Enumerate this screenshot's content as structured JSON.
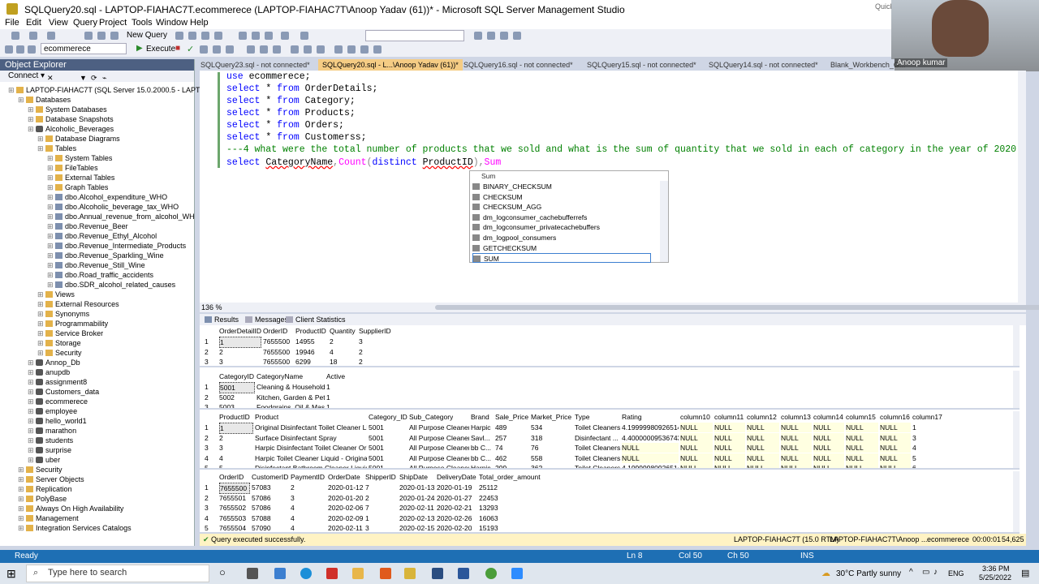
{
  "window": {
    "title": "SQLQuery20.sql - LAPTOP-FIAHAC7T.ecommerece (LAPTOP-FIAHAC7T\\Anoop Yadav (61))* - Microsoft SQL Server Management Studio",
    "quick_launch": "Quick"
  },
  "menu": [
    "File",
    "Edit",
    "View",
    "Query",
    "Project",
    "Tools",
    "Window",
    "Help"
  ],
  "toolbar": {
    "new_query": "New Query",
    "db_selector": "ecommerece",
    "execute": "Execute"
  },
  "webcam": {
    "name": "Anoop kumar"
  },
  "object_explorer": {
    "title": "Object Explorer",
    "connect": "Connect ▾",
    "nodes": [
      {
        "label": "LAPTOP-FIAHAC7T (SQL Server 15.0.2000.5 - LAPTOP-F",
        "level": 0,
        "icon": "server"
      },
      {
        "label": "Databases",
        "level": 1,
        "icon": "folder"
      },
      {
        "label": "System Databases",
        "level": 2,
        "icon": "folder"
      },
      {
        "label": "Database Snapshots",
        "level": 2,
        "icon": "folder"
      },
      {
        "label": "Alcoholic_Beverages",
        "level": 2,
        "icon": "db"
      },
      {
        "label": "Database Diagrams",
        "level": 3,
        "icon": "folder"
      },
      {
        "label": "Tables",
        "level": 3,
        "icon": "folder"
      },
      {
        "label": "System Tables",
        "level": 4,
        "icon": "folder"
      },
      {
        "label": "FileTables",
        "level": 4,
        "icon": "folder"
      },
      {
        "label": "External Tables",
        "level": 4,
        "icon": "folder"
      },
      {
        "label": "Graph Tables",
        "level": 4,
        "icon": "folder"
      },
      {
        "label": "dbo.Alcohol_expenditure_WHO",
        "level": 4,
        "icon": "table"
      },
      {
        "label": "dbo.Alcoholic_beverage_tax_WHO",
        "level": 4,
        "icon": "table"
      },
      {
        "label": "dbo.Annual_revenue_from_alcohol_WH",
        "level": 4,
        "icon": "table"
      },
      {
        "label": "dbo.Revenue_Beer",
        "level": 4,
        "icon": "table"
      },
      {
        "label": "dbo.Revenue_Ethyl_Alcohol",
        "level": 4,
        "icon": "table"
      },
      {
        "label": "dbo.Revenue_Intermediate_Products",
        "level": 4,
        "icon": "table"
      },
      {
        "label": "dbo.Revenue_Sparkling_Wine",
        "level": 4,
        "icon": "table"
      },
      {
        "label": "dbo.Revenue_Still_Wine",
        "level": 4,
        "icon": "table"
      },
      {
        "label": "dbo.Road_traffic_accidents",
        "level": 4,
        "icon": "table"
      },
      {
        "label": "dbo.SDR_alcohol_related_causes",
        "level": 4,
        "icon": "table"
      },
      {
        "label": "Views",
        "level": 3,
        "icon": "folder"
      },
      {
        "label": "External Resources",
        "level": 3,
        "icon": "folder"
      },
      {
        "label": "Synonyms",
        "level": 3,
        "icon": "folder"
      },
      {
        "label": "Programmability",
        "level": 3,
        "icon": "folder"
      },
      {
        "label": "Service Broker",
        "level": 3,
        "icon": "folder"
      },
      {
        "label": "Storage",
        "level": 3,
        "icon": "folder"
      },
      {
        "label": "Security",
        "level": 3,
        "icon": "folder"
      },
      {
        "label": "Annop_Db",
        "level": 2,
        "icon": "db"
      },
      {
        "label": "anupdb",
        "level": 2,
        "icon": "db"
      },
      {
        "label": "assignment8",
        "level": 2,
        "icon": "db"
      },
      {
        "label": "Customers_data",
        "level": 2,
        "icon": "db"
      },
      {
        "label": "ecommerece",
        "level": 2,
        "icon": "db"
      },
      {
        "label": "employee",
        "level": 2,
        "icon": "db"
      },
      {
        "label": "hello_world1",
        "level": 2,
        "icon": "db"
      },
      {
        "label": "marathon",
        "level": 2,
        "icon": "db"
      },
      {
        "label": "students",
        "level": 2,
        "icon": "db"
      },
      {
        "label": "surprise",
        "level": 2,
        "icon": "db"
      },
      {
        "label": "uber",
        "level": 2,
        "icon": "db"
      },
      {
        "label": "Security",
        "level": 1,
        "icon": "folder"
      },
      {
        "label": "Server Objects",
        "level": 1,
        "icon": "folder"
      },
      {
        "label": "Replication",
        "level": 1,
        "icon": "folder"
      },
      {
        "label": "PolyBase",
        "level": 1,
        "icon": "folder"
      },
      {
        "label": "Always On High Availability",
        "level": 1,
        "icon": "folder"
      },
      {
        "label": "Management",
        "level": 1,
        "icon": "folder"
      },
      {
        "label": "Integration Services Catalogs",
        "level": 1,
        "icon": "folder"
      }
    ]
  },
  "tabs": [
    {
      "label": "SQLQuery23.sql - not connected*",
      "active": false
    },
    {
      "label": "SQLQuery20.sql - L...\\Anoop Yadav (61))*",
      "active": true
    },
    {
      "label": "SQLQuery16.sql - not connected*",
      "active": false
    },
    {
      "label": "SQLQuery15.sql - not connected*",
      "active": false
    },
    {
      "label": "SQLQuery14.sql - not connected*",
      "active": false
    },
    {
      "label": "Blank_Workbench_G...",
      "active": false
    }
  ],
  "editor": {
    "lines": [
      "use ecommerece;",
      "select * from OrderDetails;",
      "select * from Category;",
      "select * from Products;",
      "select * from Orders;",
      "select * from Customerss;",
      "---4 what were the total number of products that we sold and what is the sum of quantity that we sold in each of category in the year of 2020",
      "select CategoryName,Count(distinct ProductID),Sum"
    ],
    "zoom": "136 %"
  },
  "autocomplete": {
    "header": "Sum",
    "items": [
      "BINARY_CHECKSUM",
      "CHECKSUM",
      "CHECKSUM_AGG",
      "dm_logconsumer_cachebufferrefs",
      "dm_logconsumer_privatecachebuffers",
      "dm_logpool_consumers",
      "GETCHECKSUM",
      "SUM"
    ]
  },
  "result_tabs": [
    "Results",
    "Messages",
    "Client Statistics"
  ],
  "grid1": {
    "columns": [
      "OrderDetailID",
      "OrderID",
      "ProductID",
      "Quantity",
      "SupplierID"
    ],
    "rows": [
      [
        "1",
        "7655500",
        "14955",
        "2",
        "3"
      ],
      [
        "2",
        "7655500",
        "19946",
        "4",
        "2"
      ],
      [
        "3",
        "7655500",
        "6299",
        "18",
        "2"
      ]
    ]
  },
  "grid2": {
    "columns": [
      "CategoryID",
      "CategoryName",
      "Active"
    ],
    "rows": [
      [
        "5001",
        "Cleaning & Household",
        "1"
      ],
      [
        "5002",
        "Kitchen, Garden & Pets",
        "1"
      ],
      [
        "5003",
        "Foodgrains, Oil & Mas...",
        "1"
      ]
    ]
  },
  "grid3": {
    "columns": [
      "ProductID",
      "Product",
      "Category_ID",
      "Sub_Category",
      "Brand",
      "Sale_Price",
      "Market_Price",
      "Type",
      "Rating",
      "column10",
      "column11",
      "column12",
      "column13",
      "column14",
      "column15",
      "column16",
      "column17"
    ],
    "rows": [
      [
        "1",
        "Original Disinfectant Toilet Cleaner Liquid",
        "5001",
        "All Purpose Cleaners",
        "Harpic",
        "489",
        "534",
        "Toilet Cleaners",
        "4.19999980926514",
        "NULL",
        "NULL",
        "NULL",
        "NULL",
        "NULL",
        "NULL",
        "NULL",
        "1"
      ],
      [
        "2",
        "Surface Disinfectant Spray",
        "5001",
        "All Purpose Cleaners",
        "Savl...",
        "257",
        "318",
        "Disinfectant ...",
        "4.40000009536743",
        "NULL",
        "NULL",
        "NULL",
        "NULL",
        "NULL",
        "NULL",
        "NULL",
        "3"
      ],
      [
        "3",
        "Harpic Disinfectant Toilet Cleaner Origi...",
        "5001",
        "All Purpose Cleaners",
        "bb C...",
        "74",
        "76",
        "Toilet Cleaners",
        "NULL",
        "NULL",
        "NULL",
        "NULL",
        "NULL",
        "NULL",
        "NULL",
        "NULL",
        "4"
      ],
      [
        "4",
        "Harpic Toilet Cleaner Liquid - Original 1...",
        "5001",
        "All Purpose Cleaners",
        "bb C...",
        "462",
        "558",
        "Toilet Cleaners",
        "NULL",
        "NULL",
        "NULL",
        "NULL",
        "NULL",
        "NULL",
        "NULL",
        "NULL",
        "5"
      ],
      [
        "5",
        "Disinfectant Bathroom Cleaner Liquid -...",
        "5001",
        "All Purpose Cleaners",
        "Harpic",
        "299",
        "362",
        "Toilet Cleaners",
        "4.19999980926514",
        "NULL",
        "NULL",
        "NULL",
        "NULL",
        "NULL",
        "NULL",
        "NULL",
        "6"
      ]
    ]
  },
  "grid4": {
    "columns": [
      "OrderID",
      "CustomerID",
      "PaymentID",
      "OrderDate",
      "ShipperID",
      "ShipDate",
      "DeliveryDate",
      "Total_order_amount"
    ],
    "rows": [
      [
        "7655500",
        "57083",
        "2",
        "2020-01-12",
        "7",
        "2020-01-13",
        "2020-01-19",
        "25112"
      ],
      [
        "7655501",
        "57086",
        "3",
        "2020-01-20",
        "2",
        "2020-01-24",
        "2020-01-27",
        "22453"
      ],
      [
        "7655502",
        "57086",
        "4",
        "2020-02-06",
        "7",
        "2020-02-11",
        "2020-02-21",
        "13293"
      ],
      [
        "7655503",
        "57088",
        "4",
        "2020-02-09",
        "1",
        "2020-02-13",
        "2020-02-26",
        "16063"
      ],
      [
        "7655504",
        "57090",
        "4",
        "2020-02-11",
        "3",
        "2020-02-15",
        "2020-02-20",
        "15193"
      ]
    ]
  },
  "query_status": {
    "message": "Query executed successfully.",
    "server": "LAPTOP-FIAHAC7T (15.0 RTM)",
    "user": "LAPTOP-FIAHAC7T\\Anoop ...",
    "database": "ecommerece",
    "time": "00:00:01",
    "rows": "54,625 rows"
  },
  "statusbar": {
    "ready": "Ready",
    "ln": "Ln 8",
    "col": "Col 50",
    "ch": "Ch 50",
    "mode": "INS"
  },
  "taskbar": {
    "search_placeholder": "Type here to search",
    "weather": "30°C  Partly sunny",
    "lang": "ENG",
    "time": "3:36 PM",
    "date": "5/25/2022"
  }
}
